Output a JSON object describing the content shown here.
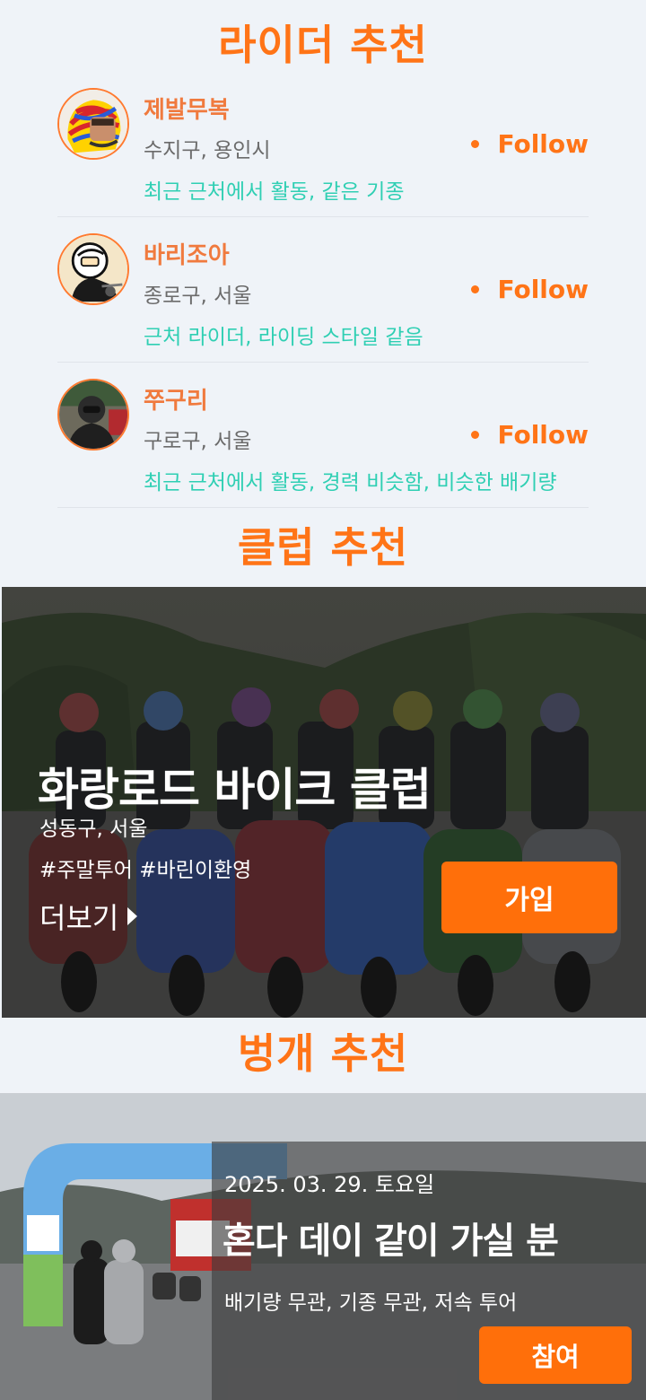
{
  "riders_section": {
    "title": "라이더 추천",
    "riders": [
      {
        "name": "제발무복",
        "location": "수지구, 용인시",
        "reason": "최근 근처에서 활동, 같은 기종",
        "follow_label": "Follow"
      },
      {
        "name": "바리조아",
        "location": "종로구, 서울",
        "reason": "근처 라이더, 라이딩 스타일 같음",
        "follow_label": "Follow"
      },
      {
        "name": "쭈구리",
        "location": "구로구, 서울",
        "reason": "최근 근처에서 활동, 경력 비슷함, 비슷한 배기량",
        "follow_label": "Follow"
      }
    ]
  },
  "clubs_section": {
    "title": "클럽 추천",
    "club": {
      "name": "화랑로드 바이크 클럽",
      "location": "성동구, 서울",
      "tags": "#주말투어 #바린이환영",
      "more_label": "더보기",
      "join_label": "가입"
    }
  },
  "meetups_section": {
    "title": "벙개 추천",
    "meetup": {
      "date": "2025. 03. 29. 토요일",
      "title": "혼다 데이 같이 가실 분",
      "description": "배기량 무관, 기종 무관, 저속 투어",
      "join_label": "참여"
    }
  },
  "colors": {
    "accent": "#ff7417",
    "reason_text": "#2fcfb3",
    "background": "#eff3f8"
  }
}
